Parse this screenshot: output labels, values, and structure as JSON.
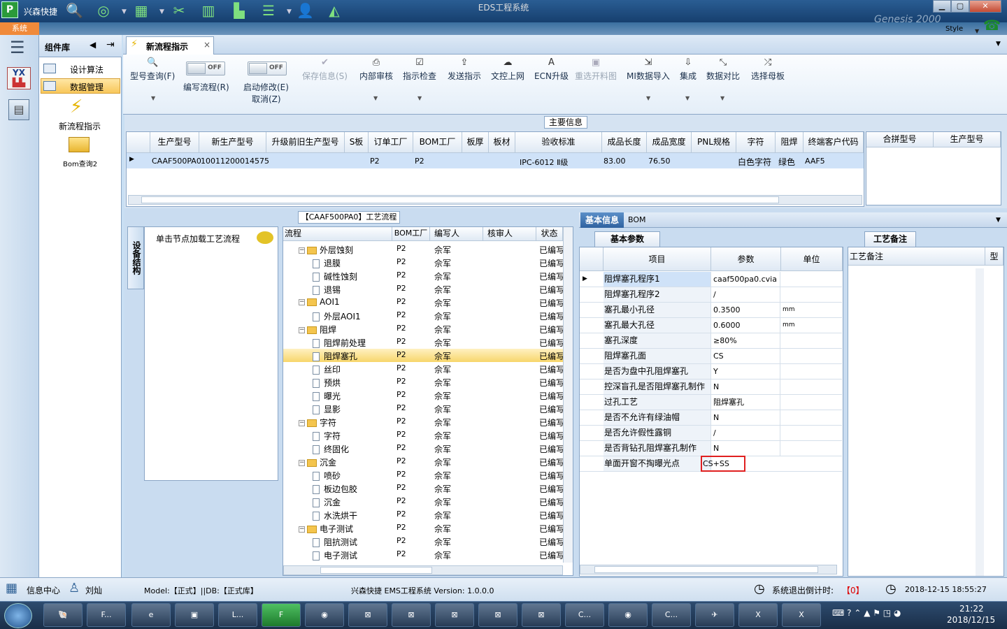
{
  "titlebar": {
    "app_name": "兴森快捷",
    "window_title": "EDS工程系统",
    "style_label": "Style",
    "min": "▁",
    "max": "▢",
    "close": "✕",
    "banner": "Genesis 2000"
  },
  "sysbar": {
    "tab": "系统"
  },
  "component_lib": {
    "title": "组件库",
    "items": [
      {
        "label": "设计算法"
      },
      {
        "label": "数据管理"
      }
    ],
    "launchers": [
      {
        "label": "新流程指示"
      },
      {
        "label": "Bom查询2"
      }
    ]
  },
  "tabs": {
    "active": "新流程指示",
    "close": "×"
  },
  "toolbar": {
    "model_query": "型号查询(F)",
    "edit_flow": "编写流程(R)",
    "enable_modify": "启动修改(E)",
    "cancel": "取消(Z)",
    "off": "OFF",
    "save_info": "保存信息(S)",
    "internal_review": "内部审核",
    "instruction_check": "指示检查",
    "send_instruction": "发送指示",
    "doc_upload": "文控上网",
    "ecn_upgrade": "ECN升级",
    "reselect_material": "重选开料图",
    "mi_import": "MI数据导入",
    "integrate": "集成",
    "data_compare": "数据对比",
    "select_mother": "选择母板"
  },
  "main_info": {
    "title": "主要信息",
    "columns": [
      "生产型号",
      "新生产型号",
      "升级前旧生产型号",
      "S板",
      "订单工厂",
      "BOM工厂",
      "板厚",
      "板材",
      "验收标准",
      "成品长度",
      "成品宽度",
      "PNL规格",
      "字符",
      "阻焊",
      "终端客户代码"
    ],
    "row": [
      "CAAF500PA0",
      "10011200014575",
      "",
      "",
      "P2",
      "P2",
      "",
      "",
      "IPC-6012 Ⅱ级",
      "83.00",
      "76.50",
      "",
      "白色字符",
      "绿色",
      "AAF5"
    ],
    "side_columns": [
      "合拼型号",
      "生产型号"
    ]
  },
  "process": {
    "title": "【CAAF500PA0】工艺流程",
    "vertical_tab": "设备结构",
    "load_hint": "单击节点加载工艺流程",
    "columns": [
      "流程",
      "BOM工厂",
      "编写人",
      "核审人",
      "状态"
    ],
    "rows": [
      {
        "name": "外层蚀刻",
        "level": 0,
        "factory": "P2",
        "writer": "佘军",
        "status": "已编写"
      },
      {
        "name": "退膜",
        "level": 1,
        "factory": "P2",
        "writer": "佘军",
        "status": "已编写"
      },
      {
        "name": "碱性蚀刻",
        "level": 1,
        "factory": "P2",
        "writer": "佘军",
        "status": "已编写"
      },
      {
        "name": "退锡",
        "level": 1,
        "factory": "P2",
        "writer": "佘军",
        "status": "已编写"
      },
      {
        "name": "AOI1",
        "level": 0,
        "factory": "P2",
        "writer": "佘军",
        "status": "已编写"
      },
      {
        "name": "外层AOI1",
        "level": 1,
        "factory": "P2",
        "writer": "佘军",
        "status": "已编写"
      },
      {
        "name": "阻焊",
        "level": 0,
        "factory": "P2",
        "writer": "佘军",
        "status": "已编写"
      },
      {
        "name": "阻焊前处理",
        "level": 1,
        "factory": "P2",
        "writer": "佘军",
        "status": "已编写"
      },
      {
        "name": "阻焊塞孔",
        "level": 1,
        "factory": "P2",
        "writer": "佘军",
        "status": "已编写",
        "selected": true
      },
      {
        "name": "丝印",
        "level": 1,
        "factory": "P2",
        "writer": "佘军",
        "status": "已编写"
      },
      {
        "name": "预烘",
        "level": 1,
        "factory": "P2",
        "writer": "佘军",
        "status": "已编写"
      },
      {
        "name": "曝光",
        "level": 1,
        "factory": "P2",
        "writer": "佘军",
        "status": "已编写"
      },
      {
        "name": "显影",
        "level": 1,
        "factory": "P2",
        "writer": "佘军",
        "status": "已编写"
      },
      {
        "name": "字符",
        "level": 0,
        "factory": "P2",
        "writer": "佘军",
        "status": "已编写"
      },
      {
        "name": "字符",
        "level": 1,
        "factory": "P2",
        "writer": "佘军",
        "status": "已编写"
      },
      {
        "name": "终固化",
        "level": 1,
        "factory": "P2",
        "writer": "佘军",
        "status": "已编写"
      },
      {
        "name": "沉金",
        "level": 0,
        "factory": "P2",
        "writer": "佘军",
        "status": "已编写"
      },
      {
        "name": "喷砂",
        "level": 1,
        "factory": "P2",
        "writer": "佘军",
        "status": "已编写"
      },
      {
        "name": "板边包胶",
        "level": 1,
        "factory": "P2",
        "writer": "佘军",
        "status": "已编写"
      },
      {
        "name": "沉金",
        "level": 1,
        "factory": "P2",
        "writer": "佘军",
        "status": "已编写"
      },
      {
        "name": "水洗烘干",
        "level": 1,
        "factory": "P2",
        "writer": "佘军",
        "status": "已编写"
      },
      {
        "name": "电子测试",
        "level": 0,
        "factory": "P2",
        "writer": "佘军",
        "status": "已编写"
      },
      {
        "name": "阻抗测试",
        "level": 1,
        "factory": "P2",
        "writer": "佘军",
        "status": "已编写"
      },
      {
        "name": "电子测试",
        "level": 1,
        "factory": "P2",
        "writer": "佘军",
        "status": "已编写"
      }
    ]
  },
  "params": {
    "tabs": [
      "基本信息",
      "BOM"
    ],
    "sub_tab": "基本参数",
    "columns": [
      "项目",
      "参数",
      "单位"
    ],
    "rows": [
      {
        "item": "阻焊塞孔程序1",
        "value": "caaf500pa0.cvia",
        "unit": ""
      },
      {
        "item": "阻焊塞孔程序2",
        "value": "/",
        "unit": ""
      },
      {
        "item": "塞孔最小孔径",
        "value": "0.3500",
        "unit": "mm"
      },
      {
        "item": "塞孔最大孔径",
        "value": "0.6000",
        "unit": "mm"
      },
      {
        "item": "塞孔深度",
        "value": "≥80%",
        "unit": ""
      },
      {
        "item": "阻焊塞孔面",
        "value": "CS",
        "unit": ""
      },
      {
        "item": "是否为盘中孔阻焊塞孔",
        "value": "Y",
        "unit": ""
      },
      {
        "item": "控深盲孔是否阻焊塞孔制作",
        "value": "N",
        "unit": ""
      },
      {
        "item": "过孔工艺",
        "value": "阻焊塞孔",
        "unit": ""
      },
      {
        "item": "是否不允许有绿油帽",
        "value": "N",
        "unit": ""
      },
      {
        "item": "是否允许假性露铜",
        "value": "/",
        "unit": ""
      },
      {
        "item": "是否背钻孔阻焊塞孔制作",
        "value": "N",
        "unit": ""
      },
      {
        "item": "单面开窗不掏曝光点",
        "value": "CS+SS",
        "unit": "",
        "highlight": true
      }
    ]
  },
  "remarks": {
    "tab": "工艺备注",
    "column": "工艺备注",
    "column2": "型"
  },
  "statusbar": {
    "info_center": "信息中心",
    "user": "刘灿",
    "model_db": "Model:【正式】||DB:【正式库】",
    "version": "兴森快捷 EMS工程系统 Version: 1.0.0.0",
    "countdown_label": "系统退出倒计时:",
    "countdown_value": "【0】",
    "datetime": "2018-12-15 18:55:27"
  },
  "taskbar": {
    "items": [
      "F...",
      "L...",
      "C...",
      "C..."
    ],
    "time": "21:22",
    "date": "2018/12/15"
  }
}
